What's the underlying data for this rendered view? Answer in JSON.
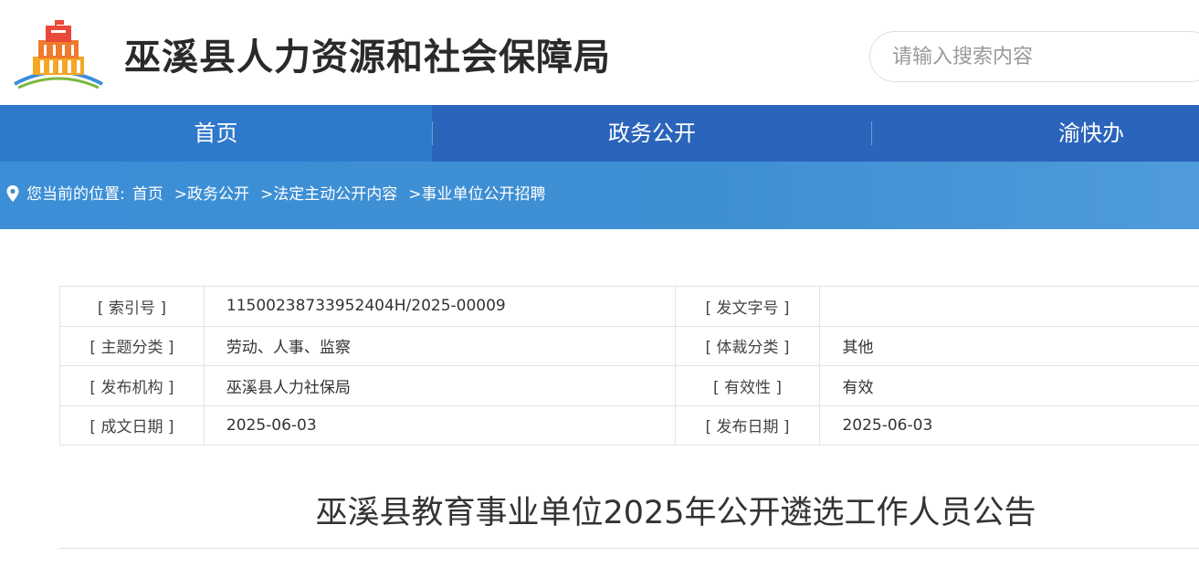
{
  "header": {
    "site_title": "巫溪县人力资源和社会保障局",
    "search_placeholder": "请输入搜索内容"
  },
  "nav": {
    "items": [
      {
        "label": "首页"
      },
      {
        "label": "政务公开"
      },
      {
        "label": "渝快办"
      }
    ]
  },
  "breadcrumb": {
    "prefix": "您当前的位置:",
    "links": [
      "首页",
      ">政务公开",
      ">法定主动公开内容",
      ">事业单位公开招聘"
    ]
  },
  "meta": {
    "rows": [
      {
        "l1": "[ 索引号 ]",
        "v1": "11500238733952404H/2025-00009",
        "l2": "[ 发文字号 ]",
        "v2": ""
      },
      {
        "l1": "[ 主题分类 ]",
        "v1": "劳动、人事、监察",
        "l2": "[ 体裁分类 ]",
        "v2": "其他"
      },
      {
        "l1": "[ 发布机构 ]",
        "v1": "巫溪县人力社保局",
        "l2": "[ 有效性 ]",
        "v2": "有效"
      },
      {
        "l1": "[ 成文日期 ]",
        "v1": "2025-06-03",
        "l2": "[ 发布日期 ]",
        "v2": "2025-06-03"
      }
    ]
  },
  "article": {
    "title": "巫溪县教育事业单位2025年公开遴选工作人员公告"
  },
  "colors": {
    "nav_bg": "#2a64bb",
    "nav_active": "#2f79cb",
    "crumb_band": "#3f8fd3"
  }
}
